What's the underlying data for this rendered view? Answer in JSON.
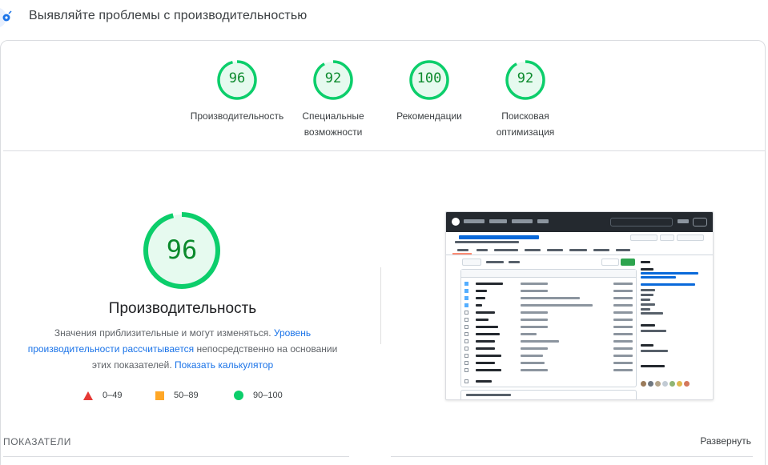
{
  "header": {
    "title": "Выявляйте проблемы с производительностью",
    "icon": "lighthouse-icon"
  },
  "categories": [
    {
      "score": "96",
      "label_lines": [
        "Производительность"
      ],
      "color": "#0cce6b"
    },
    {
      "score": "92",
      "label_lines": [
        "Специальные",
        "возможности"
      ],
      "color": "#0cce6b"
    },
    {
      "score": "100",
      "label_lines": [
        "Рекомендации"
      ],
      "color": "#0cce6b"
    },
    {
      "score": "92",
      "label_lines": [
        "Поисковая",
        "оптимизация"
      ],
      "color": "#0cce6b"
    }
  ],
  "performance": {
    "score": "96",
    "title": "Производительность",
    "desc_text_1": "Значения приблизительные и могут изменяться. ",
    "desc_link_1": "Уровень производительности рассчитывается",
    "desc_text_2": " непосредственно на основании этих показателей. ",
    "desc_link_2": "Показать калькулятор"
  },
  "legend": [
    {
      "range": "0–49",
      "shape": "triangle",
      "color": "#e53935"
    },
    {
      "range": "50–89",
      "shape": "square",
      "color": "#ffa726"
    },
    {
      "range": "90–100",
      "shape": "circle",
      "color": "#0cce6b"
    }
  ],
  "metrics": {
    "section_title": "ПОКАЗАТЕЛИ",
    "expand_label": "Развернуть"
  },
  "colors": {
    "pass": "#0cce6b",
    "pass_text": "#0b8a2c",
    "link": "#1a73e8"
  }
}
